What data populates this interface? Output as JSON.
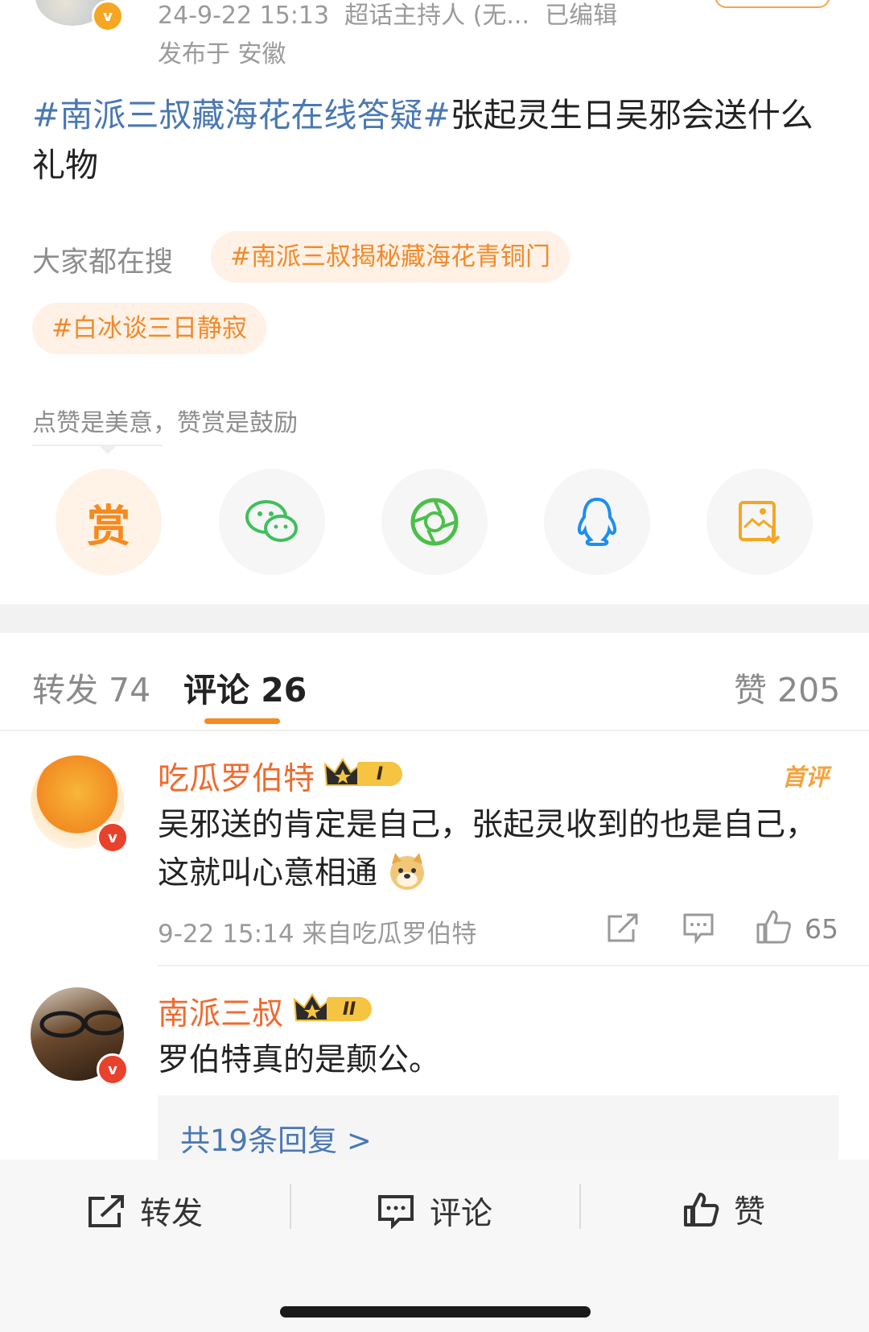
{
  "post": {
    "meta_time": "24-9-22 15:13",
    "meta_host": "超话主持人 (无...",
    "meta_edited": "已编辑",
    "location": "发布于 安徽",
    "topic": "#南派三叔藏海花在线答疑#",
    "text": "张起灵生日吴邪会送什么礼物"
  },
  "search": {
    "label": "大家都在搜",
    "chips": [
      "#南派三叔揭秘藏海花青铜门",
      "#白冰谈三日静寂"
    ]
  },
  "reward_tip": "点赞是美意，赞赏是鼓励",
  "share": {
    "reward_label": "赏",
    "icons": [
      "reward-icon",
      "wechat-icon",
      "moments-icon",
      "qq-icon",
      "save-image-icon"
    ]
  },
  "tabs": {
    "repost": "转发 74",
    "comments": "评论 26",
    "likes": "赞 205"
  },
  "comments": [
    {
      "name": "吃瓜罗伯特",
      "level": "I",
      "badge": "首评",
      "text": "吴邪送的肯定是自己，张起灵收到的也是自己，这就叫心意相通",
      "meta": "9-22 15:14  来自吃瓜罗伯特",
      "likes": "65"
    },
    {
      "name": "南派三叔",
      "level": "II",
      "text": "罗伯特真的是颠公。",
      "replies": "共19条回复 >"
    }
  ],
  "bottom_bar": {
    "repost": "转发",
    "comment": "评论",
    "like": "赞"
  },
  "colors": {
    "accent": "#f58a1f",
    "topic_blue": "#4a78b3",
    "name_orange": "#f06a2e"
  }
}
